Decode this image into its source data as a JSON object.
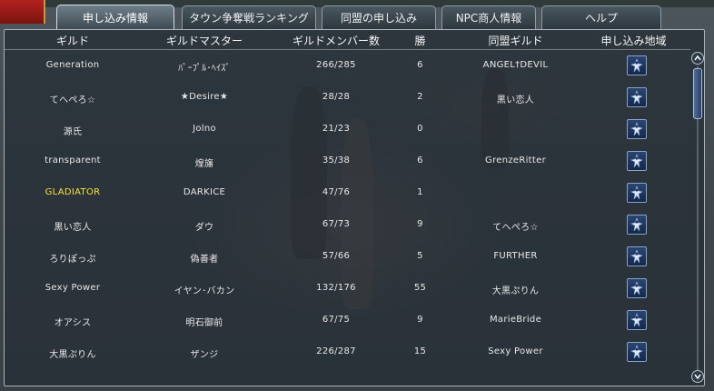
{
  "tabs": [
    {
      "label": "申し込み情報",
      "active": true
    },
    {
      "label": "タウン争奪戦ランキング",
      "active": false
    },
    {
      "label": "同盟の申し込み",
      "active": false
    },
    {
      "label": "NPC商人情報",
      "active": false
    },
    {
      "label": "ヘルプ",
      "active": false
    }
  ],
  "columns": {
    "guild": "ギルド",
    "master": "ギルドマスター",
    "members": "ギルドメンバー数",
    "wins": "勝",
    "allied": "同盟ギルド",
    "apply_area": "申し込み地域"
  },
  "rows": [
    {
      "guild": "Generation",
      "master": "ﾊﾟｰﾌﾟﾙ･ﾍｲｽﾞ",
      "members": "266/285",
      "wins": "6",
      "allied": "ANGEL†DEVIL",
      "highlight": false
    },
    {
      "guild": "てへぺろ☆",
      "master": "★Desire★",
      "members": "28/28",
      "wins": "2",
      "allied": "黒い恋人",
      "highlight": false
    },
    {
      "guild": "源氏",
      "master": "Jolno",
      "members": "21/23",
      "wins": "0",
      "allied": "",
      "highlight": false
    },
    {
      "guild": "transparent",
      "master": "煌旛",
      "members": "35/38",
      "wins": "6",
      "allied": "GrenzeRitter",
      "highlight": false
    },
    {
      "guild": "GLADIATOR",
      "master": "DARKICE",
      "members": "47/76",
      "wins": "1",
      "allied": "",
      "highlight": true
    },
    {
      "guild": "黒い恋人",
      "master": "ダウ",
      "members": "67/73",
      "wins": "9",
      "allied": "てへぺろ☆",
      "highlight": false
    },
    {
      "guild": "ろりぽっぷ",
      "master": "偽善者",
      "members": "57/66",
      "wins": "5",
      "allied": "FURTHER",
      "highlight": false
    },
    {
      "guild": "Sexy Power",
      "master": "イヤン･バカン",
      "members": "132/176",
      "wins": "55",
      "allied": "大黒ぷりん",
      "highlight": false
    },
    {
      "guild": "オアシス",
      "master": "明石御前",
      "members": "67/75",
      "wins": "9",
      "allied": "MarieBride",
      "highlight": false
    },
    {
      "guild": "大黒ぷりん",
      "master": "ザンジ",
      "members": "226/287",
      "wins": "15",
      "allied": "Sexy Power",
      "highlight": false
    }
  ],
  "icons": {
    "apply": "warrior-emblem-icon",
    "scroll_up": "chevron-up-icon",
    "scroll_down": "chevron-down-icon"
  },
  "colors": {
    "highlight_guild": "#f4e23a",
    "button_bg": "#1c3560"
  }
}
